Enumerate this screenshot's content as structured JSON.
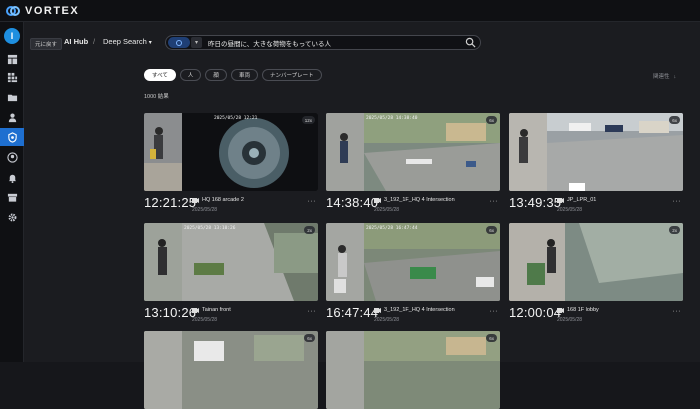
{
  "app": {
    "logo": "VORTEX"
  },
  "sidebar": {
    "avatar_letter": "I",
    "items": [
      {
        "icon": "dashboard-icon"
      },
      {
        "icon": "apps-grid-icon"
      },
      {
        "icon": "folder-icon"
      },
      {
        "icon": "person-icon"
      },
      {
        "icon": "ai-hub-icon",
        "active": true
      },
      {
        "icon": "user-circle-icon"
      },
      {
        "icon": "bell-icon"
      },
      {
        "icon": "archive-icon"
      },
      {
        "icon": "gear-icon"
      }
    ]
  },
  "header": {
    "back_label": "元に戻す",
    "breadcrumb_hub": "AI Hub",
    "breadcrumb_sep": "/",
    "breadcrumb_current": "Deep Search",
    "breadcrumb_chevron": "▾"
  },
  "search": {
    "query": "昨日の昼間に、大きな荷物をもっている人",
    "mode_chevron": "▾"
  },
  "filters": [
    {
      "label": "すべて",
      "active": true
    },
    {
      "label": "人",
      "active": false
    },
    {
      "label": "顔",
      "active": false
    },
    {
      "label": "車両",
      "active": false
    },
    {
      "label": "ナンバープレート",
      "active": false
    }
  ],
  "sort": {
    "label": "関連性",
    "arrow": "↓"
  },
  "results": {
    "count_text": "1000 結果"
  },
  "cards": [
    {
      "time": "12:21:25",
      "camera": "HQ 168 arcade 2",
      "date": "2025/05/28",
      "badge": "12x",
      "osd": "2025/05/28 12:21",
      "more": "···"
    },
    {
      "time": "14:38:40",
      "camera": "3_192_1F_HQ 4 Intersection",
      "date": "2025/05/28",
      "badge": "6x",
      "osd": "2025/05/28 14:38:40",
      "more": "···"
    },
    {
      "time": "13:49:35",
      "camera": "JP_LPR_01",
      "date": "2025/05/28",
      "badge": "6x",
      "osd": "",
      "more": "···"
    },
    {
      "time": "13:10:26",
      "camera": "Tainan front",
      "date": "2025/05/28",
      "badge": "2x",
      "osd": "2025/05/28 13:10:26",
      "more": "···"
    },
    {
      "time": "16:47:44",
      "camera": "3_192_1F_HQ 4 Intersection",
      "date": "2025/05/28",
      "badge": "6x",
      "osd": "2025/05/28 16:47:44",
      "more": "···"
    },
    {
      "time": "12:00:04",
      "camera": "168 1F lobby",
      "date": "2025/05/28",
      "badge": "2x",
      "osd": "",
      "more": "···"
    },
    {
      "time": "",
      "camera": "",
      "date": "",
      "badge": "6x",
      "osd": "",
      "more": ""
    },
    {
      "time": "",
      "camera": "",
      "date": "",
      "badge": "6x",
      "osd": "",
      "more": ""
    }
  ]
}
